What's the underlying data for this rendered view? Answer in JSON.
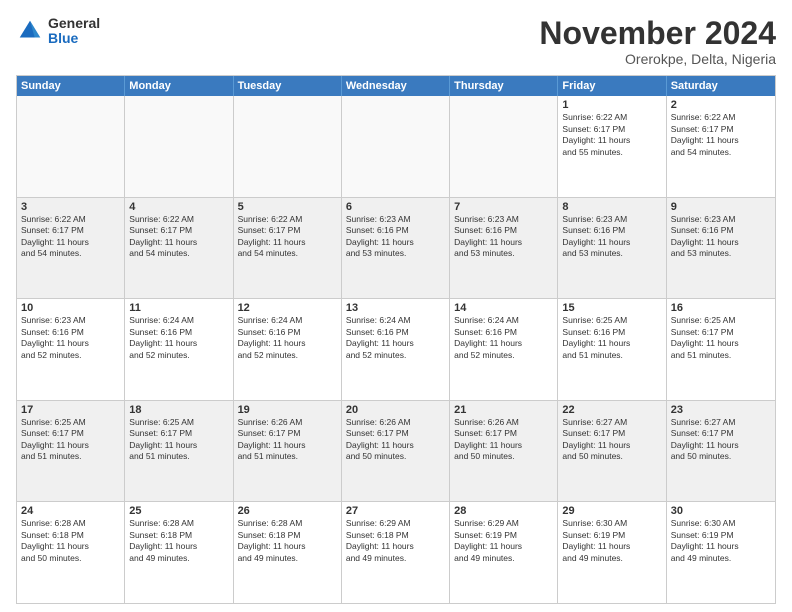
{
  "logo": {
    "general": "General",
    "blue": "Blue"
  },
  "title": "November 2024",
  "location": "Orerokpe, Delta, Nigeria",
  "header_days": [
    "Sunday",
    "Monday",
    "Tuesday",
    "Wednesday",
    "Thursday",
    "Friday",
    "Saturday"
  ],
  "rows": [
    [
      {
        "day": "",
        "info": ""
      },
      {
        "day": "",
        "info": ""
      },
      {
        "day": "",
        "info": ""
      },
      {
        "day": "",
        "info": ""
      },
      {
        "day": "",
        "info": ""
      },
      {
        "day": "1",
        "info": "Sunrise: 6:22 AM\nSunset: 6:17 PM\nDaylight: 11 hours\nand 55 minutes."
      },
      {
        "day": "2",
        "info": "Sunrise: 6:22 AM\nSunset: 6:17 PM\nDaylight: 11 hours\nand 54 minutes."
      }
    ],
    [
      {
        "day": "3",
        "info": "Sunrise: 6:22 AM\nSunset: 6:17 PM\nDaylight: 11 hours\nand 54 minutes."
      },
      {
        "day": "4",
        "info": "Sunrise: 6:22 AM\nSunset: 6:17 PM\nDaylight: 11 hours\nand 54 minutes."
      },
      {
        "day": "5",
        "info": "Sunrise: 6:22 AM\nSunset: 6:17 PM\nDaylight: 11 hours\nand 54 minutes."
      },
      {
        "day": "6",
        "info": "Sunrise: 6:23 AM\nSunset: 6:16 PM\nDaylight: 11 hours\nand 53 minutes."
      },
      {
        "day": "7",
        "info": "Sunrise: 6:23 AM\nSunset: 6:16 PM\nDaylight: 11 hours\nand 53 minutes."
      },
      {
        "day": "8",
        "info": "Sunrise: 6:23 AM\nSunset: 6:16 PM\nDaylight: 11 hours\nand 53 minutes."
      },
      {
        "day": "9",
        "info": "Sunrise: 6:23 AM\nSunset: 6:16 PM\nDaylight: 11 hours\nand 53 minutes."
      }
    ],
    [
      {
        "day": "10",
        "info": "Sunrise: 6:23 AM\nSunset: 6:16 PM\nDaylight: 11 hours\nand 52 minutes."
      },
      {
        "day": "11",
        "info": "Sunrise: 6:24 AM\nSunset: 6:16 PM\nDaylight: 11 hours\nand 52 minutes."
      },
      {
        "day": "12",
        "info": "Sunrise: 6:24 AM\nSunset: 6:16 PM\nDaylight: 11 hours\nand 52 minutes."
      },
      {
        "day": "13",
        "info": "Sunrise: 6:24 AM\nSunset: 6:16 PM\nDaylight: 11 hours\nand 52 minutes."
      },
      {
        "day": "14",
        "info": "Sunrise: 6:24 AM\nSunset: 6:16 PM\nDaylight: 11 hours\nand 52 minutes."
      },
      {
        "day": "15",
        "info": "Sunrise: 6:25 AM\nSunset: 6:16 PM\nDaylight: 11 hours\nand 51 minutes."
      },
      {
        "day": "16",
        "info": "Sunrise: 6:25 AM\nSunset: 6:17 PM\nDaylight: 11 hours\nand 51 minutes."
      }
    ],
    [
      {
        "day": "17",
        "info": "Sunrise: 6:25 AM\nSunset: 6:17 PM\nDaylight: 11 hours\nand 51 minutes."
      },
      {
        "day": "18",
        "info": "Sunrise: 6:25 AM\nSunset: 6:17 PM\nDaylight: 11 hours\nand 51 minutes."
      },
      {
        "day": "19",
        "info": "Sunrise: 6:26 AM\nSunset: 6:17 PM\nDaylight: 11 hours\nand 51 minutes."
      },
      {
        "day": "20",
        "info": "Sunrise: 6:26 AM\nSunset: 6:17 PM\nDaylight: 11 hours\nand 50 minutes."
      },
      {
        "day": "21",
        "info": "Sunrise: 6:26 AM\nSunset: 6:17 PM\nDaylight: 11 hours\nand 50 minutes."
      },
      {
        "day": "22",
        "info": "Sunrise: 6:27 AM\nSunset: 6:17 PM\nDaylight: 11 hours\nand 50 minutes."
      },
      {
        "day": "23",
        "info": "Sunrise: 6:27 AM\nSunset: 6:17 PM\nDaylight: 11 hours\nand 50 minutes."
      }
    ],
    [
      {
        "day": "24",
        "info": "Sunrise: 6:28 AM\nSunset: 6:18 PM\nDaylight: 11 hours\nand 50 minutes."
      },
      {
        "day": "25",
        "info": "Sunrise: 6:28 AM\nSunset: 6:18 PM\nDaylight: 11 hours\nand 49 minutes."
      },
      {
        "day": "26",
        "info": "Sunrise: 6:28 AM\nSunset: 6:18 PM\nDaylight: 11 hours\nand 49 minutes."
      },
      {
        "day": "27",
        "info": "Sunrise: 6:29 AM\nSunset: 6:18 PM\nDaylight: 11 hours\nand 49 minutes."
      },
      {
        "day": "28",
        "info": "Sunrise: 6:29 AM\nSunset: 6:19 PM\nDaylight: 11 hours\nand 49 minutes."
      },
      {
        "day": "29",
        "info": "Sunrise: 6:30 AM\nSunset: 6:19 PM\nDaylight: 11 hours\nand 49 minutes."
      },
      {
        "day": "30",
        "info": "Sunrise: 6:30 AM\nSunset: 6:19 PM\nDaylight: 11 hours\nand 49 minutes."
      }
    ]
  ]
}
